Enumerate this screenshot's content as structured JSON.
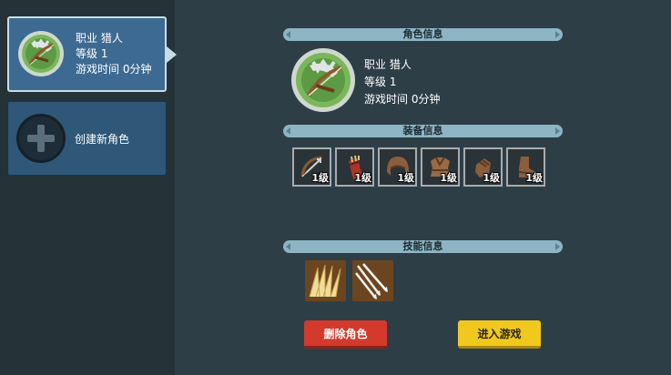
{
  "sidebar": {
    "character": {
      "class_label": "职业 猎人",
      "level_label": "等级 1",
      "playtime_label": "游戏时间 0分钟",
      "avatar_icon": "hunter-bow-icon"
    },
    "new_character": {
      "label": "创建新角色",
      "icon": "plus-icon"
    }
  },
  "sections": {
    "character_info": "角色信息",
    "equipment_info": "装备信息",
    "skill_info": "技能信息"
  },
  "character_info": {
    "class_label": "职业 猎人",
    "level_label": "等级 1",
    "playtime_label": "游戏时间 0分钟"
  },
  "equipment": [
    {
      "icon": "bow-icon",
      "level": "1级"
    },
    {
      "icon": "quiver-icon",
      "level": "1级"
    },
    {
      "icon": "helmet-icon",
      "level": "1级"
    },
    {
      "icon": "armor-icon",
      "level": "1级"
    },
    {
      "icon": "gloves-icon",
      "level": "1级"
    },
    {
      "icon": "boots-icon",
      "level": "1级"
    }
  ],
  "skills": [
    {
      "icon": "arrow-volley-icon"
    },
    {
      "icon": "multi-shot-icon"
    }
  ],
  "buttons": {
    "delete": "删除角色",
    "enter": "进入游戏"
  },
  "colors": {
    "delete_button": "#d33a2c",
    "enter_button": "#f1c91e",
    "selected_card": "#3d6a92",
    "section_bar": "#8db5c4"
  }
}
